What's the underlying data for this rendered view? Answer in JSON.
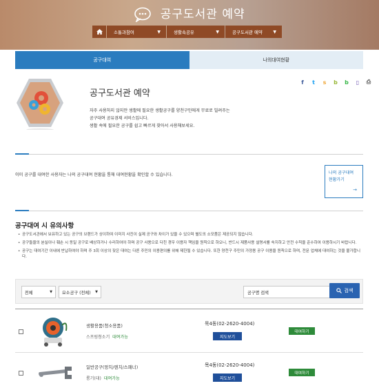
{
  "header": {
    "title": "공구도서관 예약",
    "nav": [
      "소통과참여",
      "생활속공유",
      "공구도서관 예약"
    ]
  },
  "tabs": [
    {
      "label": "공구대여",
      "active": true
    },
    {
      "label": "나의대여현황",
      "active": false
    }
  ],
  "intro": {
    "title": "공구도서관 예약",
    "desc": [
      "자주 사용하지 않지만 생활에 필요한 생활공구를 양천구민에게 무료로 빌려주는",
      "공구대여 공유경제 서비스입니다.",
      "생활 속에 필요한 공구를 쉽고 빠르게 찾아서 사용해보세요."
    ]
  },
  "share_icons": [
    "facebook-icon",
    "twitter-icon",
    "kakaostory-icon",
    "band-icon",
    "blog-icon",
    "bookmark-icon",
    "print-icon"
  ],
  "info_text": "이미 공구를 대여한 사용자는 나의 공구대여 현황을 통해 대여현황을 확인할 수 있습니다.",
  "rental_box": {
    "line1": "나의 공구대여",
    "line2": "현황가기",
    "arrow": "→"
  },
  "notice": {
    "title": "공구대여 시 유의사항",
    "items": [
      "공구도서관에서 보유하고 있는 공구의 브랜드가 상이하여 이미지 사진이 실제 공구와 차이가 있을 수 있으며 별도의 소모품은 제공되지 않습니다.",
      "공구들을의 분실이나 훼손 시 동일 공구로 배상하거나 수리하여야 하며 공구 사용으로 다친 경우 이용자 책임을 원칙으로 하오니, 반드시 제품사용 설명서를 숙지하고 안전 수칙을 준수하여 이용하시기 바랍니다.",
      "공구는 대여기간 이내에 반납하여야 하며 주 3회 이상의 잦은 대여는 다른 주민의 이용편의를 위해 제한될 수 있습니다. 또한 양천구 주민의 가정용 공구 이용을 원칙으로 하며, 전문 업체에 대여하는 것을 불가합니다."
    ]
  },
  "search": {
    "select1": "전체",
    "select2": "요소공구 (전체)",
    "placeholder": "공구명 검색",
    "button": "검색"
  },
  "tools": [
    {
      "name": "생활용품(청소용품)",
      "category": "스프링청소기",
      "status": "대여가능",
      "location": "목4동(02-2620-4004)",
      "map": "지도보기",
      "rent": "대여하기"
    },
    {
      "name": "일반공구(망치/렌치/스패너)",
      "category": "롱기(대)",
      "status": "대여가능",
      "location": "목4동(02-2620-4004)",
      "map": "지도보기",
      "rent": "대여하기"
    }
  ],
  "colors": {
    "primary": "#2a7cbf",
    "nav": "#8f4a26",
    "available": "#2e8b3a"
  }
}
